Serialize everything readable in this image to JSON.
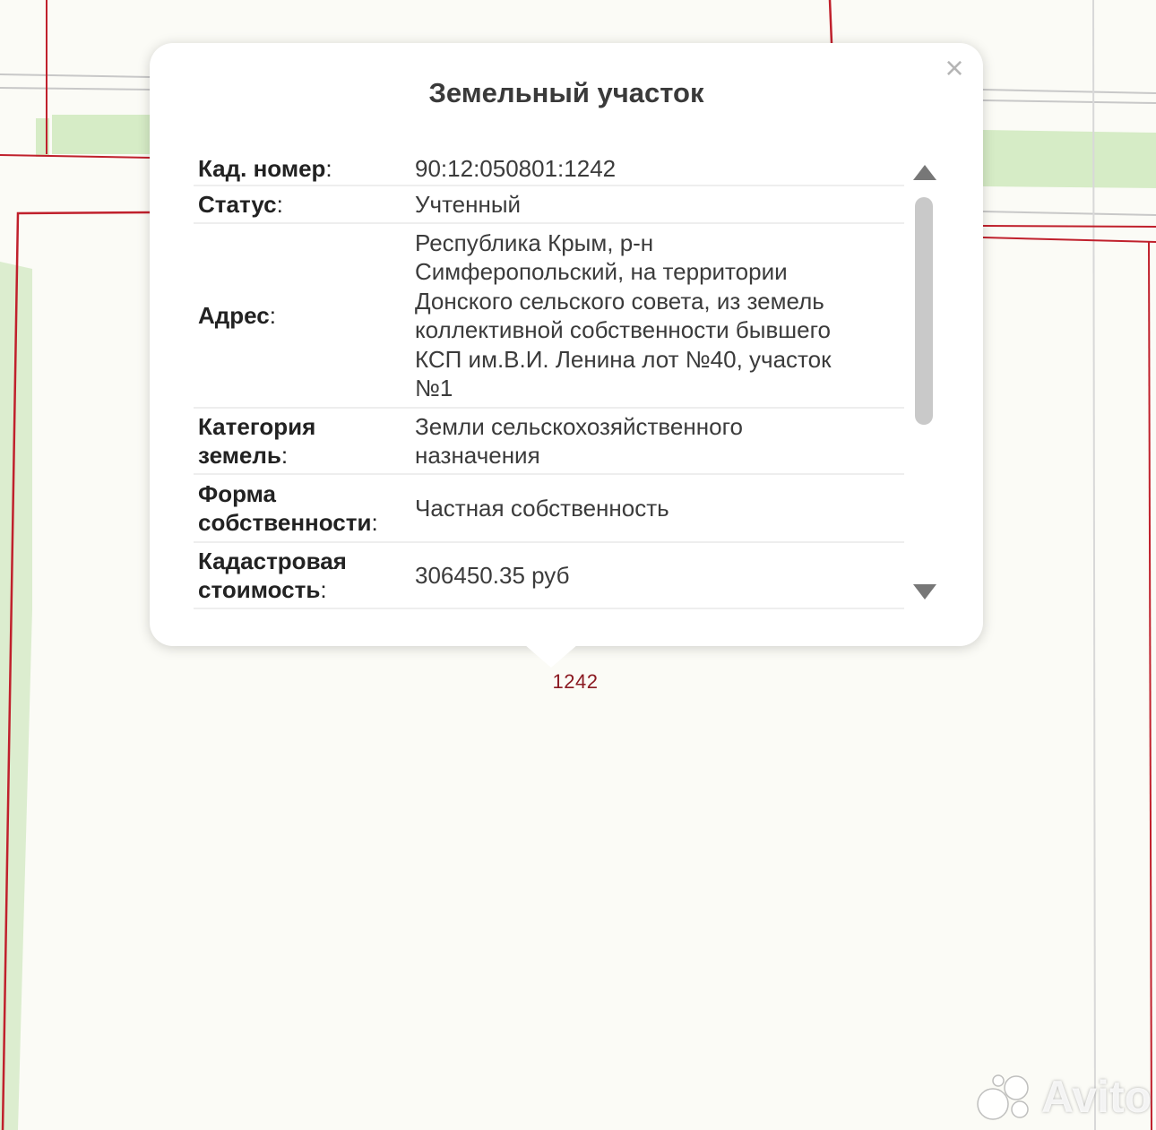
{
  "popup": {
    "title": "Земельный участок",
    "close_glyph": "×",
    "rows": [
      {
        "key": "Кад. номер",
        "value": "90:12:050801:1242"
      },
      {
        "key": "Статус",
        "value": "Учтенный"
      },
      {
        "key": "Адрес",
        "value_lines": [
          "Республика Крым, р-н",
          "Симферопольский, на территории",
          "Донского сельского совета, из земель",
          "коллективной собственности бывшего",
          "КСП им.В.И. Ленина лот №40, участок",
          "№1"
        ]
      },
      {
        "key_lines": [
          "Категория",
          "земель"
        ],
        "value_lines": [
          "Земли сельскохозяйственного",
          "назначения"
        ]
      },
      {
        "key_lines": [
          "Форма",
          "собственности"
        ],
        "value": "Частная собственность"
      },
      {
        "key_lines": [
          "Кадастровая",
          "стоимость"
        ],
        "value": "306450.35 руб"
      }
    ]
  },
  "map": {
    "parcel_label": "1242",
    "boundary_color": "#c0202c",
    "green_strip_color": "#d6ecc6"
  },
  "watermark": {
    "text": "Avito",
    "icon": "avito-logo-icon"
  }
}
